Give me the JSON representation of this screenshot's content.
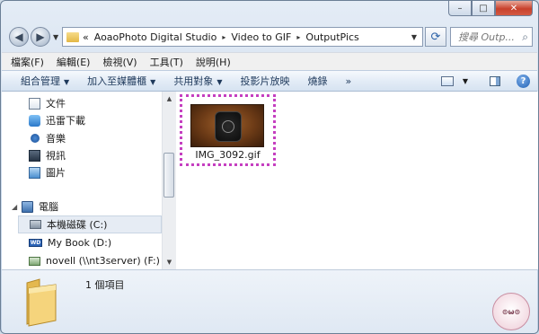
{
  "titlebar": {
    "minimize_icon": "minimize-icon",
    "maximize_icon": "maximize-icon",
    "close_icon": "close-icon"
  },
  "address": {
    "overflow": "«",
    "breadcrumbs": [
      "AoaoPhoto Digital Studio",
      "Video to GIF",
      "OutputPics"
    ],
    "separator": "▸",
    "search_placeholder": "搜尋 Outp..."
  },
  "menu": {
    "items": [
      "檔案(F)",
      "編輯(E)",
      "檢視(V)",
      "工具(T)",
      "說明(H)"
    ]
  },
  "commands": {
    "organize": "組合管理",
    "add_to_library": "加入至媒體櫃",
    "share_with": "共用對象",
    "slideshow": "投影片放映",
    "burn": "燒錄",
    "more": "»"
  },
  "nav": {
    "items": [
      {
        "label": "文件",
        "icon": "document-icon"
      },
      {
        "label": "迅雷下載",
        "icon": "download-icon"
      },
      {
        "label": "音樂",
        "icon": "music-icon"
      },
      {
        "label": "視訊",
        "icon": "video-icon"
      },
      {
        "label": "圖片",
        "icon": "pictures-icon"
      },
      {
        "label": "電腦",
        "icon": "computer-icon"
      },
      {
        "label": "本機磁碟 (C:)",
        "icon": "local-disk-icon"
      },
      {
        "label": "My Book (D:)",
        "icon": "external-drive-icon"
      },
      {
        "label": "novell (\\\\nt3server) (F:)",
        "icon": "network-drive-icon"
      }
    ]
  },
  "content": {
    "files": [
      {
        "name": "IMG_3092.gif",
        "icon": "gif-thumbnail"
      }
    ]
  },
  "details": {
    "item_count": "1 個項目"
  },
  "colors": {
    "selection_border": "#c53fc0",
    "chrome": "#c9d8ea",
    "close_button": "#c8412c"
  }
}
